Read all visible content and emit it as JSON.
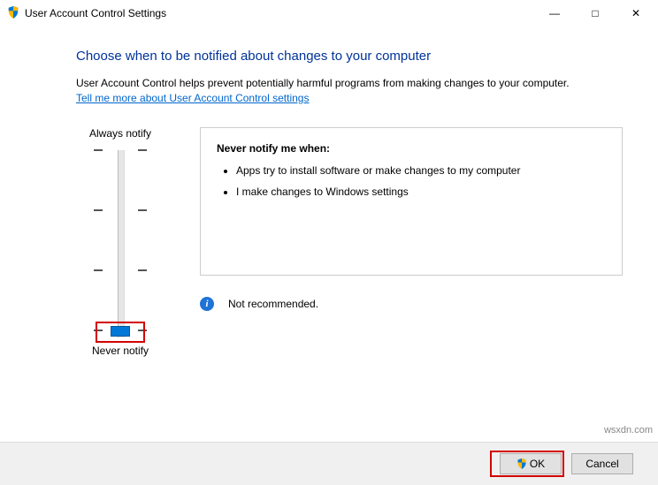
{
  "titlebar": {
    "title": "User Account Control Settings"
  },
  "heading": "Choose when to be notified about changes to your computer",
  "subtext": "User Account Control helps prevent potentially harmful programs from making changes to your computer.",
  "link": "Tell me more about User Account Control settings",
  "slider": {
    "top_label": "Always notify",
    "bottom_label": "Never notify"
  },
  "description": {
    "title": "Never notify me when:",
    "bullets": [
      "Apps try to install software or make changes to my computer",
      "I make changes to Windows settings"
    ],
    "recommend": "Not recommended."
  },
  "buttons": {
    "ok": "OK",
    "cancel": "Cancel"
  },
  "watermark": "wsxdn.com"
}
